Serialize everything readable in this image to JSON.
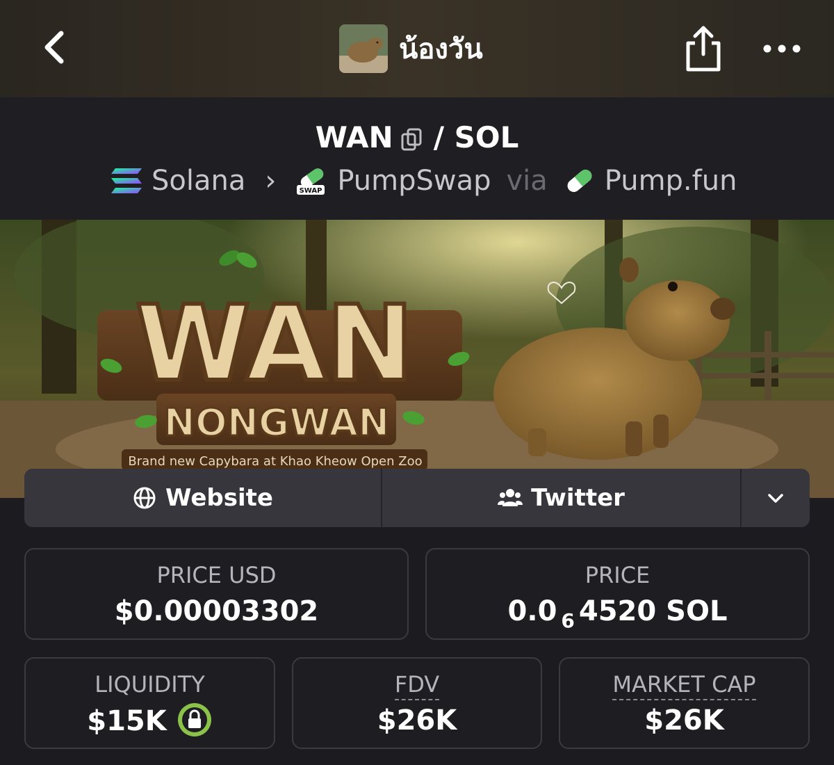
{
  "header": {
    "token_name": "น้องวัน",
    "back_icon": "chevron-left-icon",
    "share_icon": "share-icon",
    "more_icon": "more-horizontal-icon"
  },
  "pair": {
    "base": "WAN",
    "separator": "/",
    "quote": "SOL",
    "chain": "Solana",
    "dex": "PumpSwap",
    "via": "via",
    "launchpad": "Pump.fun"
  },
  "banner": {
    "title": "WAN",
    "subtitle": "NONGWAN",
    "tagline": "Brand new Capybara at Khao Kheow Open Zoo"
  },
  "links": {
    "website": "Website",
    "twitter": "Twitter"
  },
  "stats": {
    "price_usd_label": "PRICE USD",
    "price_usd_value": "$0.00003302",
    "price_label": "PRICE",
    "price_prefix": "0.0",
    "price_zeros": "6",
    "price_suffix": "4520 SOL",
    "liquidity_label": "LIQUIDITY",
    "liquidity_value": "$15K",
    "fdv_label": "FDV",
    "fdv_value": "$26K",
    "mcap_label": "MARKET CAP",
    "mcap_value": "$26K"
  },
  "colors": {
    "background": "#1c1c20",
    "card_border": "#3a3a40",
    "lock_green": "#8bc34a"
  }
}
